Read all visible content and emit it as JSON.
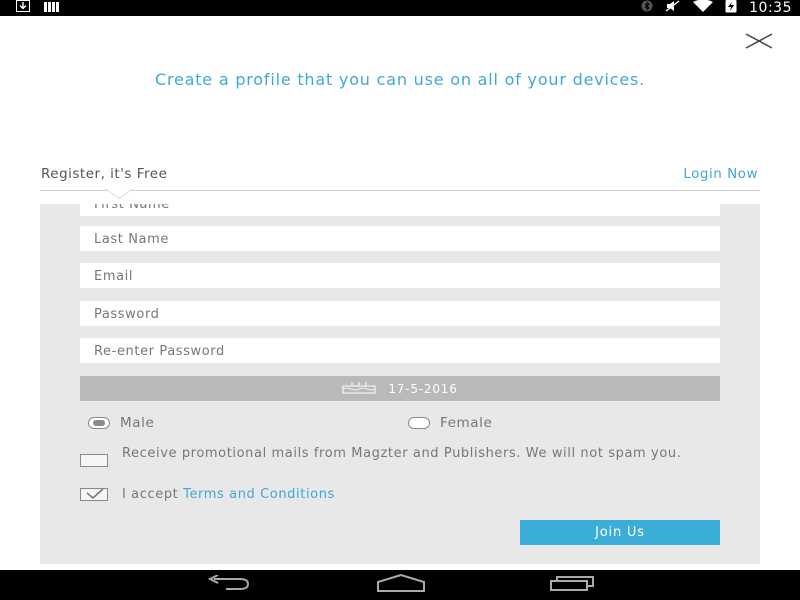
{
  "status_bar": {
    "time": "10:35",
    "left_icons": [
      "download-icon",
      "signal-bars-icon"
    ],
    "right_icons": [
      "bluetooth-icon",
      "mute-icon",
      "wifi-icon",
      "battery-charging-icon"
    ]
  },
  "headline": "Create a profile that you can use on all of your devices.",
  "tabs": {
    "register_label": "Register, it's Free",
    "login_label": "Login Now"
  },
  "form": {
    "fields": {
      "first_name_placeholder": "First Name",
      "last_name_placeholder": "Last Name",
      "email_placeholder": "Email",
      "password_placeholder": "Password",
      "reenter_password_placeholder": "Re-enter Password"
    },
    "birthdate": "17-5-2016",
    "gender": {
      "male_label": "Male",
      "female_label": "Female",
      "selected": "Male"
    },
    "promo_text": "Receive promotional mails from Magzter and Publishers. We will not spam you.",
    "promo_checked": false,
    "accept_prefix": "I accept",
    "terms_label": "Terms and Conditions",
    "terms_checked": true,
    "join_label": "Join Us"
  },
  "nav_bar": {
    "icons": [
      "back-icon",
      "home-icon",
      "recents-icon"
    ]
  },
  "colors": {
    "accent": "#3fa8d6",
    "join_button": "#3aaed8",
    "panel": "#e8e8e8",
    "date_button": "#b9b9b9"
  }
}
